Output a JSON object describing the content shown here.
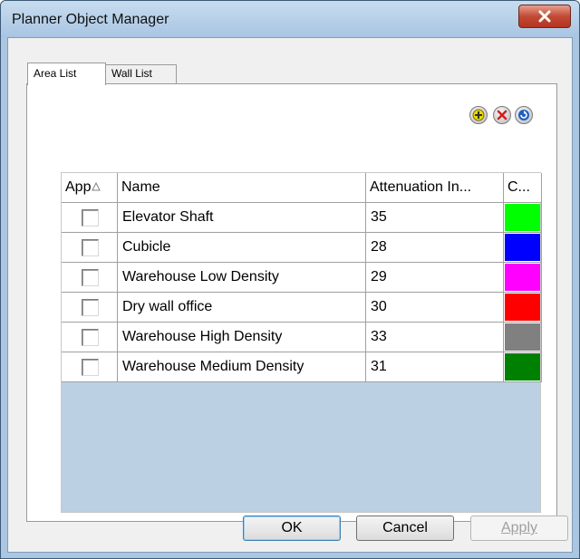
{
  "window": {
    "title": "Planner Object Manager"
  },
  "tabs": [
    {
      "label": "Area List",
      "active": true
    },
    {
      "label": "Wall List",
      "active": false
    }
  ],
  "toolbar": {
    "buttons": [
      {
        "icon": "add-icon",
        "color": "#d8c800"
      },
      {
        "icon": "delete-icon",
        "color": "#d02020"
      },
      {
        "icon": "refresh-icon",
        "color": "#2060c0"
      }
    ]
  },
  "table": {
    "columns": [
      "App",
      "Name",
      "Attenuation In...",
      "C..."
    ],
    "rows": [
      {
        "checked": false,
        "name": "Elevator Shaft",
        "attenuation": "35",
        "color": "#00ff00"
      },
      {
        "checked": false,
        "name": "Cubicle",
        "attenuation": "28",
        "color": "#0000ff"
      },
      {
        "checked": false,
        "name": "Warehouse Low Density",
        "attenuation": "29",
        "color": "#ff00ff"
      },
      {
        "checked": false,
        "name": "Dry wall office",
        "attenuation": "30",
        "color": "#ff0000"
      },
      {
        "checked": false,
        "name": "Warehouse High Density",
        "attenuation": "33",
        "color": "#808080"
      },
      {
        "checked": false,
        "name": "Warehouse Medium Density",
        "attenuation": "31",
        "color": "#008000"
      }
    ]
  },
  "buttons": {
    "ok": "OK",
    "cancel": "Cancel",
    "apply": "Apply"
  }
}
